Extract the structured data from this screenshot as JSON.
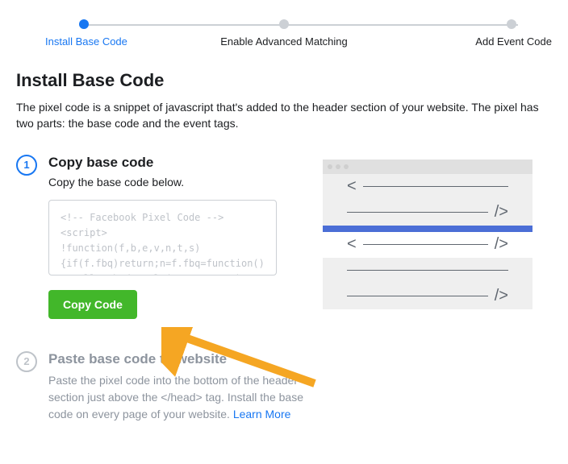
{
  "stepper": {
    "step1": "Install Base Code",
    "step2": "Enable Advanced Matching",
    "step3": "Add Event Code"
  },
  "page": {
    "title": "Install Base Code",
    "intro": "The pixel code is a snippet of javascript that's added to the header section of your website. The pixel has two parts: the base code and the event tags."
  },
  "task1": {
    "num": "1",
    "title": "Copy base code",
    "desc": "Copy the base code below.",
    "code": "<!-- Facebook Pixel Code -->\n<script>\n!function(f,b,e,v,n,t,s)\n{if(f.fbq)return;n=f.fbq=function()\nn.callMethod.apply(n,arguments)",
    "button": "Copy Code"
  },
  "task2": {
    "num": "2",
    "title": "Paste base code to website",
    "desc": "Paste the pixel code into the bottom of the header section just above the </head> tag. Install the base code on every page of your website. ",
    "link": "Learn More"
  }
}
